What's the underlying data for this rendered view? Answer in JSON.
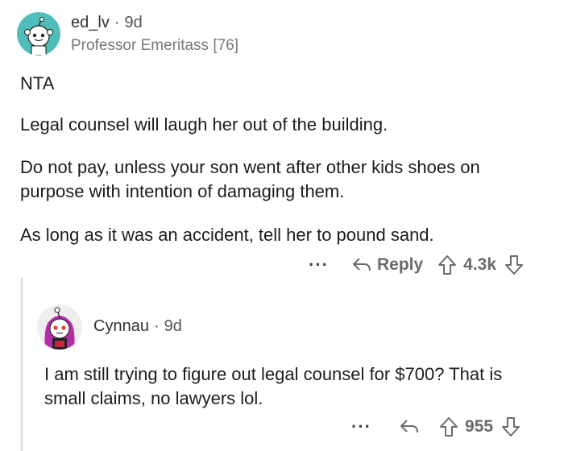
{
  "comment": {
    "username": "ed_lv",
    "separator": "·",
    "age": "9d",
    "flair": "Professor Emeritass [76]",
    "paragraphs": [
      "NTA",
      "Legal counsel will laugh her out of the building.",
      "Do not pay, unless your son went after other kids shoes on purpose with intention of damaging them.",
      "As long as it was an accident, tell her to pound sand."
    ],
    "actions": {
      "more": "···",
      "reply_label": "Reply",
      "score": "4.3k"
    }
  },
  "reply": {
    "username": "Cynnau",
    "separator": "·",
    "age": "9d",
    "paragraphs": [
      "I am still trying to figure out legal counsel for $700? That is small claims, no lawyers lol."
    ],
    "actions": {
      "more": "···",
      "score": "955"
    }
  },
  "icons": [
    "snoo-avatar-icon",
    "reply-arrow-icon",
    "upvote-arrow-icon",
    "downvote-arrow-icon",
    "more-dots-icon"
  ],
  "colors": {
    "avatar_teal": "#4fbdba",
    "action_gray": "#6b6b6b",
    "thread_line": "#d6d6d6"
  }
}
